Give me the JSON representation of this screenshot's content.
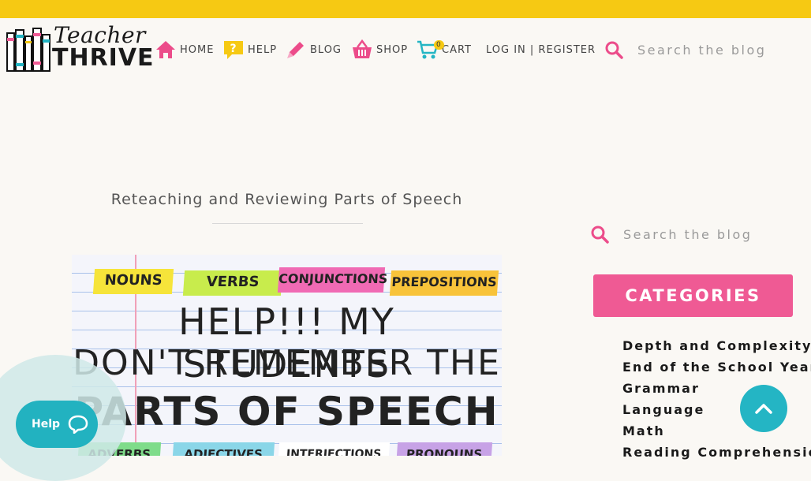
{
  "brand": {
    "line1": "Teacher",
    "line2": "THRIVE"
  },
  "nav": {
    "home": "HOME",
    "help": "HELP",
    "blog": "BLOG",
    "shop": "SHOP",
    "cart": "CART",
    "cart_count": "0",
    "login": "LOG IN | REGISTER"
  },
  "search": {
    "placeholder": "Search the blog"
  },
  "post": {
    "title": "Reteaching and Reviewing Parts of Speech",
    "image": {
      "tags_top": [
        "NOUNS",
        "VERBS",
        "CONJUNCTIONS",
        "PREPOSITIONS"
      ],
      "line1": "HELP!!! MY STUDENTS",
      "line2": "DON'T REMEMBER THE",
      "line3": "PARTS OF SPEECH",
      "tags_bottom": [
        "ADVERBS",
        "ADJECTIVES",
        "INTERJECTIONS",
        "PRONOUNS"
      ]
    }
  },
  "sidebar": {
    "search_placeholder": "Search the blog",
    "categories_title": "CATEGORIES",
    "categories": [
      "Depth and Complexity",
      "End of the School Year",
      "Grammar",
      "Language",
      "Math",
      "Reading Comprehension"
    ]
  },
  "help_widget": {
    "label": "Help"
  },
  "colors": {
    "topbar": "#f6c913",
    "accent_pink": "#ef5a94",
    "accent_teal": "#24b5c4",
    "icon_pink": "#ec4c8a"
  }
}
